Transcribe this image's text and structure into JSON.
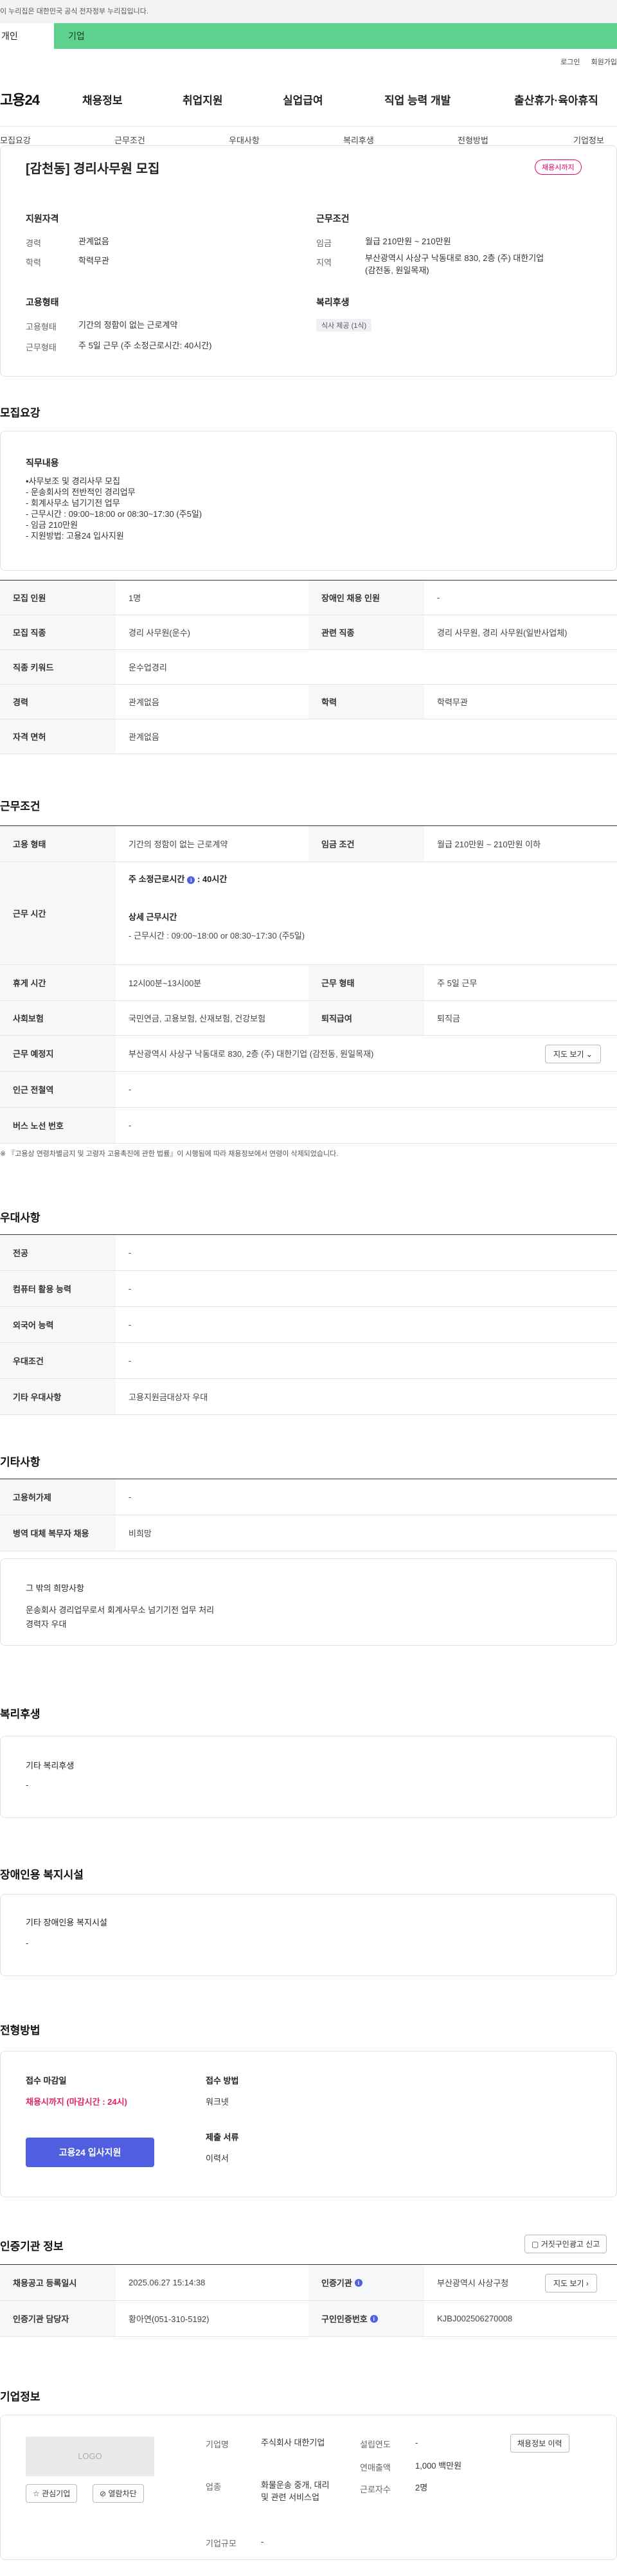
{
  "gov_banner": "이 누리집은 대한민국 공식 전자정부 누리집입니다.",
  "user_tabs": {
    "personal": "개인",
    "company": "기업"
  },
  "util": {
    "login": "로그인",
    "signup": "회원가입"
  },
  "logo": "고용24",
  "gnb": [
    "채용정보",
    "취업지원",
    "실업급여",
    "직업 능력 개발",
    "출산휴가·육아휴직"
  ],
  "anchor_tabs": [
    "모집요강",
    "근무조건",
    "우대사항",
    "복리후생",
    "전형방법",
    "기업정보"
  ],
  "summary": {
    "title": "[감천동] 경리사무원 모집",
    "badge": "채용시까지",
    "qual_label": "지원자격",
    "career_k": "경력",
    "career_v": "관계없음",
    "edu_k": "학력",
    "edu_v": "학력무관",
    "cond_label": "근무조건",
    "wage_k": "임금",
    "wage_v": "월급 210만원 ~ 210만원",
    "area_k": "지역",
    "area_v": "부산광역시 사상구 낙동대로 830, 2층 (주) 대한기업\n(감전동, 원일목재)",
    "emp_label": "고용형태",
    "emptype_k": "고용형태",
    "emptype_v": "기간의 정함이 없는 근로계약",
    "worktime_k": "근무형태",
    "worktime_v": "주 5일 근무 (주 소정근로시간: 40시간)",
    "welfare_label": "복리후생",
    "welfare_chip": "식사 제공 (1식)"
  },
  "recruit": {
    "section": "모집요강",
    "job_label": "직무내용",
    "job_text": "•사무보조 및 경리사무 모집\n- 운송회사의 전반적인 경리업무\n- 회계사무소 넘기기전 업무\n- 근무시간 : 09:00~18:00 or 08:30~17:30 (주5일)\n- 임금 210만원\n- 지원방법: 고용24 입사지원",
    "rows": [
      {
        "k1": "모집 인원",
        "v1": "1명",
        "k2": "장애인 채용 인원",
        "v2": "-"
      },
      {
        "k1": "모집 직종",
        "v1": "경리 사무원(운수)",
        "k2": "관련 직종",
        "v2": "경리 사무원, 경리 사무원(일반사업체)"
      },
      {
        "k1": "직종 키워드",
        "v1": "운수업경리"
      },
      {
        "k1": "경력",
        "v1": "관계없음",
        "k2": "학력",
        "v2": "학력무관"
      },
      {
        "k1": "자격 면허",
        "v1": "관계없음"
      }
    ]
  },
  "conditions": {
    "section": "근무조건",
    "emp_k": "고용 형태",
    "emp_v": "기간의 정함이 없는 근로계약",
    "wage_k": "임금 조건",
    "wage_v": "월급 210만원 ~ 210만원 이하",
    "hours_k": "근무 시간",
    "hours_week": "주 소정근로시간",
    "hours_week_v": ": 40시간",
    "hours_detail_label": "상세 근무시간",
    "hours_detail_v": "- 근무시간 : 09:00~18:00 or 08:30~17:30 (주5일)",
    "break_k": "휴게 시간",
    "break_v": "12시00분~13시00분",
    "form_k": "근무 형태",
    "form_v": "주 5일 근무",
    "ins_k": "사회보험",
    "ins_v": "국민연금, 고용보험, 산재보험, 건강보험",
    "sev_k": "퇴직급여",
    "sev_v": "퇴직금",
    "place_k": "근무 예정지",
    "place_v": "부산광역시 사상구 낙동대로 830, 2층 (주) 대한기업 (감전동, 원일목재)",
    "map_btn": "지도 보기",
    "subway_k": "인근 전철역",
    "subway_v": "-",
    "bus_k": "버스 노선 번호",
    "bus_v": "-",
    "note": "※ 『고용상 연령차별금지 및 고령자 고용촉진에 관한 법률』이 시행됨에 따라 채용정보에서 연령이 삭제되었습니다."
  },
  "preferences": {
    "section": "우대사항",
    "rows": [
      {
        "k": "전공",
        "v": "-"
      },
      {
        "k": "컴퓨터 활용 능력",
        "v": "-"
      },
      {
        "k": "외국어 능력",
        "v": "-"
      },
      {
        "k": "우대조건",
        "v": "-"
      },
      {
        "k": "기타 우대사항",
        "v": "고용지원금대상자 우대"
      }
    ]
  },
  "etc": {
    "section": "기타사항",
    "rows": [
      {
        "k": "고용허가제",
        "v": "-"
      },
      {
        "k": "병역 대체 복무자 채용",
        "v": "비희망"
      }
    ],
    "box_title": "그 밖의 희망사항",
    "box_text": "운송회사 경리업무로서 회계사무소 넘기기전 업무 처리\n경력자 우대"
  },
  "welfare": {
    "section": "복리후생",
    "box_title": "기타 복리후생",
    "box_text": "-"
  },
  "disability": {
    "section": "장애인용 복지시설",
    "box_title": "기타 장애인용 복지시설",
    "box_text": "-"
  },
  "selection": {
    "section": "전형방법",
    "deadline_label": "접수 마감일",
    "deadline_v": "채용시까지 (마감시간 : 24시)",
    "method_label": "접수 방법",
    "method_v": "워크넷",
    "docs_label": "제출 서류",
    "docs_v": "이력서",
    "apply_btn": "고용24 입사지원"
  },
  "cert": {
    "section": "인증기관 정보",
    "report_btn": "거짓구인광고 신고",
    "reg_k": "채용공고 등록일시",
    "reg_v": "2025.06.27 15:14:38",
    "org_k": "인증기관",
    "org_v": "부산광역시 사상구청",
    "map_btn": "지도 보기",
    "mgr_k": "인증기관 담당자",
    "mgr_v": "황아연(051-310-5192)",
    "no_k": "구인인증번호",
    "no_v": "KJBJ002506270008"
  },
  "company": {
    "section": "기업정보",
    "logo": "LOGO",
    "fav_btn": "관심기업",
    "block_btn": "열람차단",
    "name_k": "기업명",
    "name_v": "주식회사 대한기업",
    "year_k": "설립연도",
    "year_v": "-",
    "info_btn": "채용정보 이력",
    "industry_k": "업종",
    "industry_v": "화물운송 중개, 대리 및 관련 서비스업",
    "sales_k": "연매출액",
    "sales_v": "1,000 백만원",
    "emp_k": "근로자수",
    "emp_v": "2명",
    "size_k": "기업규모",
    "size_v": "-"
  }
}
